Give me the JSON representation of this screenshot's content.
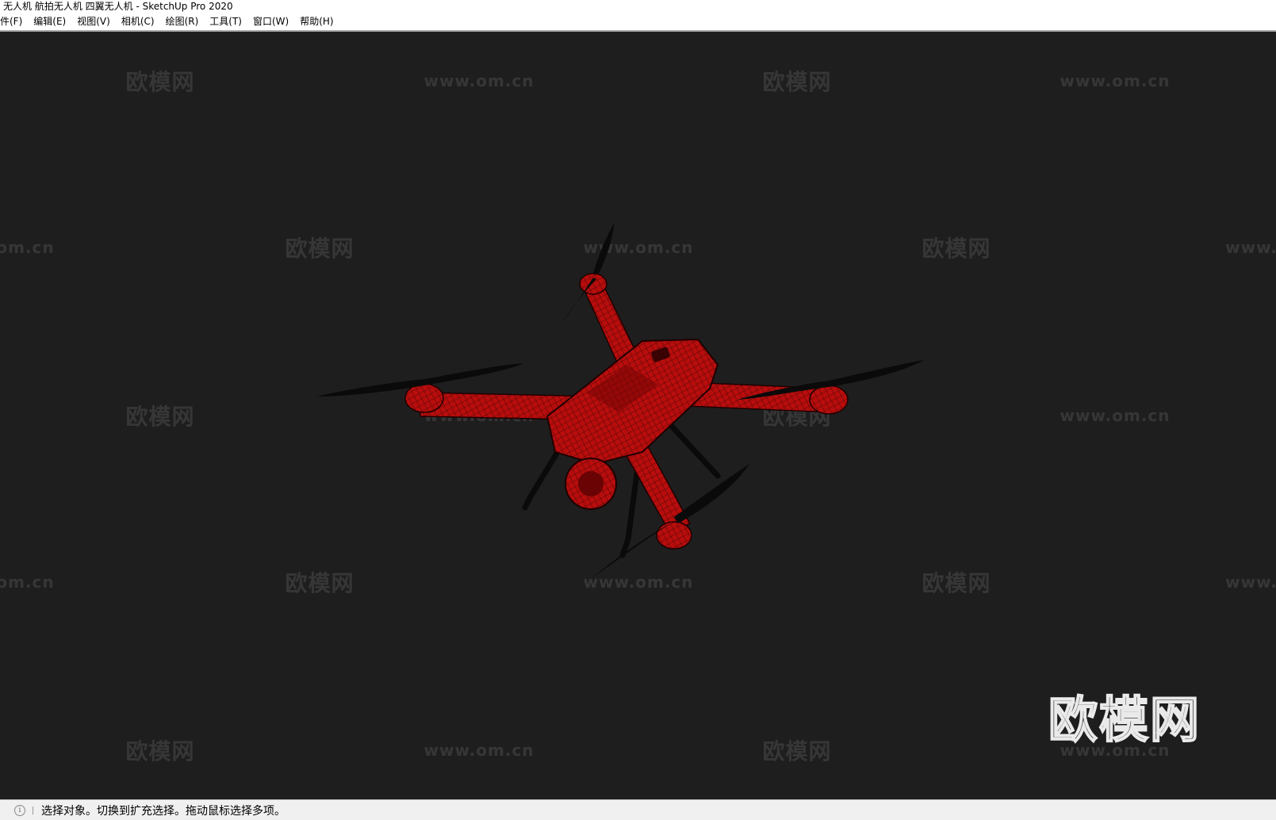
{
  "window": {
    "title": "无人机 航拍无人机 四翼无人机 - SketchUp Pro 2020"
  },
  "menu": [
    {
      "label": "件(F)"
    },
    {
      "label": "编辑(E)"
    },
    {
      "label": "视图(V)"
    },
    {
      "label": "相机(C)"
    },
    {
      "label": "绘图(R)"
    },
    {
      "label": "工具(T)"
    },
    {
      "label": "窗口(W)"
    },
    {
      "label": "帮助(H)"
    }
  ],
  "watermark": {
    "brand": "欧模网",
    "url": "www.om.cn",
    "url_left": "om.cn",
    "url_right": "www."
  },
  "status": {
    "icon": "info-icon",
    "text": "选择对象。切换到扩充选择。拖动鼠标选择多项。"
  },
  "colors": {
    "model_red": "#b80d0d",
    "viewport_bg": "#1e1e1e",
    "propeller": "#0a0a0a"
  }
}
